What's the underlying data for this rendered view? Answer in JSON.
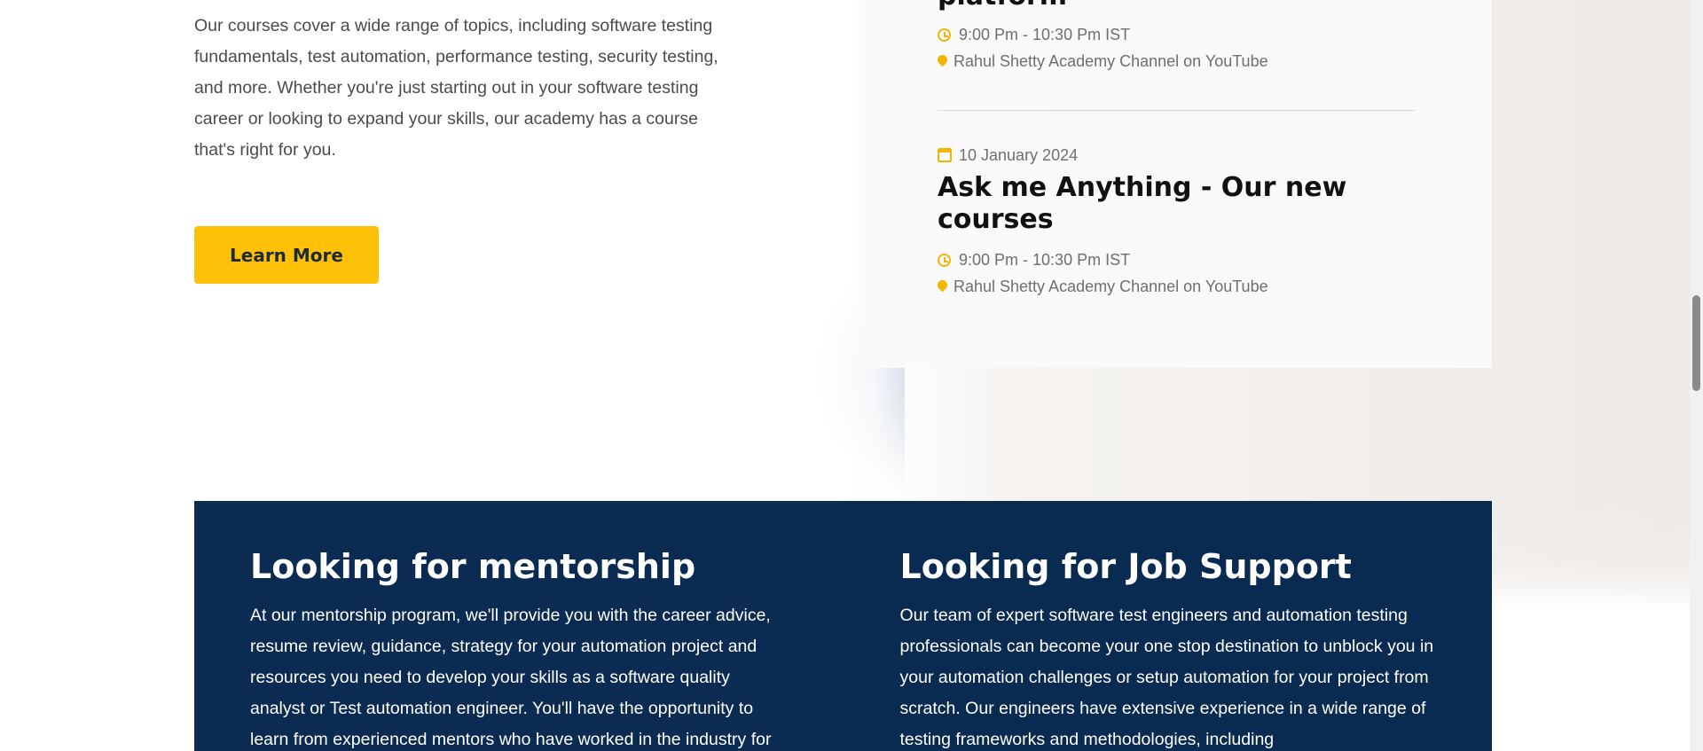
{
  "intro": {
    "text": "Our courses cover a wide range of topics, including software testing fundamentals, test automation, performance testing, security testing, and more. Whether you're just starting out in your software testing career or looking to expand your skills, our academy has a course that's right for you.",
    "button_label": "Learn More"
  },
  "events": {
    "items": [
      {
        "title": "platform",
        "time": "9:00 Pm - 10:30 Pm IST",
        "location": "Rahul Shetty Academy Channel on YouTube"
      },
      {
        "date": "10 January 2024",
        "title": "Ask me Anything - Our new courses",
        "time": "9:00 Pm - 10:30 Pm IST",
        "location": "Rahul Shetty Academy Channel on YouTube"
      }
    ]
  },
  "support": {
    "mentorship": {
      "title": "Looking for mentorship",
      "body": "At our mentorship program, we'll provide you with the career advice, resume review, guidance, strategy for your automation project and resources you need to develop your skills as a software quality analyst or Test automation engineer. You'll have the opportunity to learn from experienced mentors who have worked in the industry for"
    },
    "job_support": {
      "title": "Looking for Job Support",
      "body": "Our team of expert software test engineers and automation testing professionals can become your one stop destination to unblock you in your automation challenges or setup automation for your project from scratch. Our engineers have extensive experience in a wide range of testing frameworks and methodologies, including"
    }
  },
  "colors": {
    "accent": "#ffc107",
    "dark_panel": "#0b2b52",
    "icon": "#f4b400"
  },
  "icons": [
    "clock-icon",
    "map-pin-icon",
    "calendar-icon"
  ]
}
